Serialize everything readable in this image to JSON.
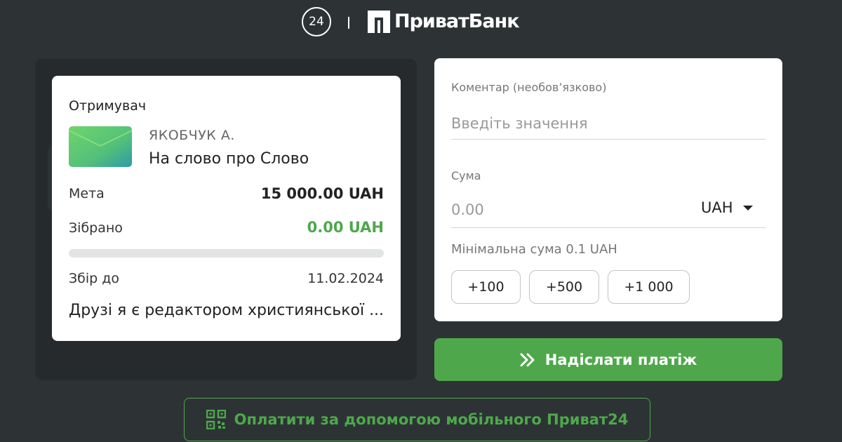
{
  "header": {
    "p24_logo_text": "24",
    "bank_name": "ПриватБанк"
  },
  "recipient": {
    "title": "Отримувач",
    "name": "ЯКОБЧУК А.",
    "campaign": "На слово про Слово",
    "goal_label": "Мета",
    "goal_value": "15 000.00 UAH",
    "collected_label": "Зібрано",
    "collected_value": "0.00 UAH",
    "progress_fraction": 0,
    "deadline_label": "Збір до",
    "deadline_value": "11.02.2024",
    "description": "Друзі я є редактором християнської ..."
  },
  "payment": {
    "comment_label": "Коментар (необов’язково)",
    "comment_placeholder": "Введіть значення",
    "amount_label": "Сума",
    "amount_placeholder": "0.00",
    "currency": "UAH",
    "min_amount_text": "Мінімальна сума 0.1 UAH",
    "quick_amounts": [
      "+100",
      "+500",
      "+1 000"
    ]
  },
  "send_button_label": "Надіслати платіж",
  "mobile_pay_label": "Оплатити за допомогою мобільного Приват24",
  "colors": {
    "background": "#2d3335",
    "accent_green": "#4ea84b",
    "card": "#ffffff"
  },
  "icons": {
    "send": "double-chevron-right-icon",
    "mobile_pay": "qr-code-icon",
    "envelope": "envelope-icon",
    "currency_caret": "caret-down-icon"
  }
}
